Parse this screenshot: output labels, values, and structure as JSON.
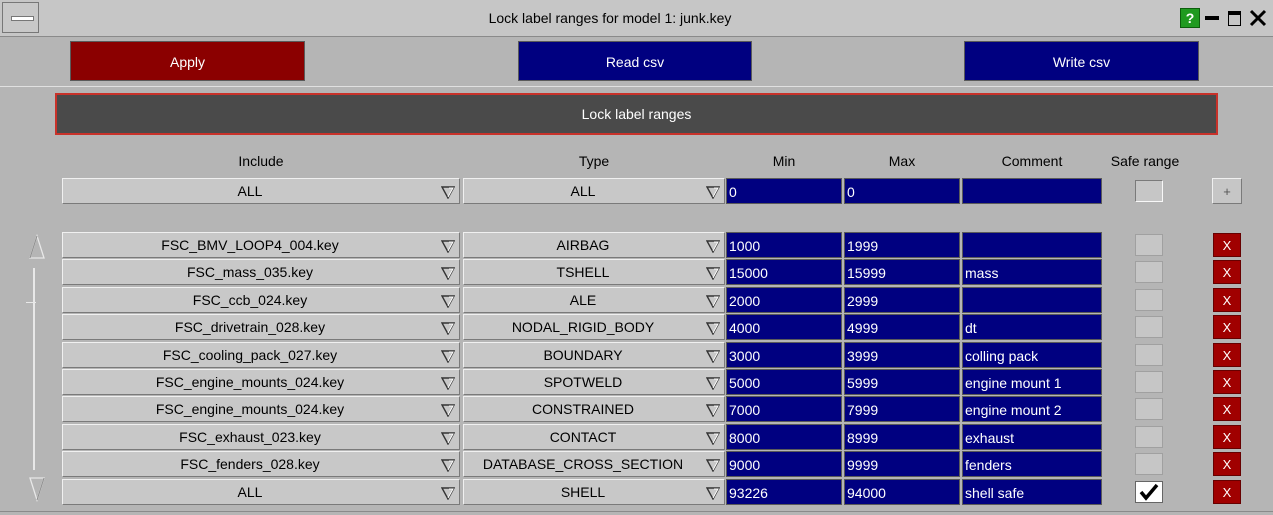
{
  "window": {
    "title": "Lock label ranges for model 1: junk.key",
    "help_label": "?"
  },
  "toolbar": {
    "apply_label": "Apply",
    "read_csv_label": "Read csv",
    "write_csv_label": "Write csv"
  },
  "section_title": "Lock label ranges",
  "columns": {
    "include": "Include",
    "type": "Type",
    "min": "Min",
    "max": "Max",
    "comment": "Comment",
    "safe_range": "Safe range"
  },
  "filter_row": {
    "include": "ALL",
    "type": "ALL",
    "min": "0",
    "max": "0",
    "comment": "",
    "safe_range": false,
    "add_label": "+"
  },
  "rows": [
    {
      "include": "FSC_BMV_LOOP4_004.key",
      "type": "AIRBAG",
      "min": "1000",
      "max": "1999",
      "comment": "",
      "safe": false
    },
    {
      "include": "FSC_mass_035.key",
      "type": "TSHELL",
      "min": "15000",
      "max": "15999",
      "comment": "mass",
      "safe": false
    },
    {
      "include": "FSC_ccb_024.key",
      "type": "ALE",
      "min": "2000",
      "max": "2999",
      "comment": "",
      "safe": false
    },
    {
      "include": "FSC_drivetrain_028.key",
      "type": "NODAL_RIGID_BODY",
      "min": "4000",
      "max": "4999",
      "comment": "dt",
      "safe": false
    },
    {
      "include": "FSC_cooling_pack_027.key",
      "type": "BOUNDARY",
      "min": "3000",
      "max": "3999",
      "comment": "colling pack",
      "safe": false
    },
    {
      "include": "FSC_engine_mounts_024.key",
      "type": "SPOTWELD",
      "min": "5000",
      "max": "5999",
      "comment": "engine mount 1",
      "safe": false
    },
    {
      "include": "FSC_engine_mounts_024.key",
      "type": "CONSTRAINED",
      "min": "7000",
      "max": "7999",
      "comment": "engine mount 2",
      "safe": false
    },
    {
      "include": "FSC_exhaust_023.key",
      "type": "CONTACT",
      "min": "8000",
      "max": "8999",
      "comment": "exhaust",
      "safe": false
    },
    {
      "include": "FSC_fenders_028.key",
      "type": "DATABASE_CROSS_SECTION",
      "min": "9000",
      "max": "9999",
      "comment": "fenders",
      "safe": false
    },
    {
      "include": "ALL",
      "type": "SHELL",
      "min": "93226",
      "max": "94000",
      "comment": "shell safe",
      "safe": true
    }
  ],
  "delete_label": "X",
  "icons": {
    "dropdown": "dropdown-triangle-icon",
    "scroll_up": "scroll-up-arrow-icon",
    "scroll_down": "scroll-down-arrow-icon",
    "check": "checkmark-icon",
    "close": "close-icon",
    "minimize": "minimize-icon",
    "maximize": "maximize-icon"
  },
  "colors": {
    "apply_bg": "#8b0000",
    "csv_bg": "#000080",
    "field_bg": "#000080",
    "delete_bg": "#a00000",
    "section_bg": "#4a4a4a",
    "section_border": "#c8322a",
    "help_bg": "#1f9a1f"
  }
}
